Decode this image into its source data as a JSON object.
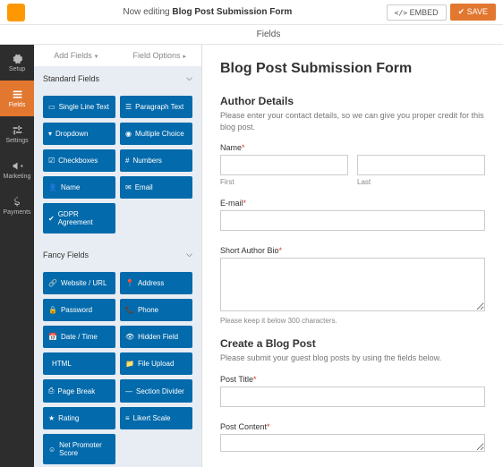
{
  "top": {
    "editing_prefix": "Now editing ",
    "form_name": "Blog Post Submission Form",
    "embed": "EMBED",
    "save": "SAVE"
  },
  "headTab": "Fields",
  "sidebar": [
    {
      "label": "Setup",
      "icon": "gear"
    },
    {
      "label": "Fields",
      "icon": "list"
    },
    {
      "label": "Settings",
      "icon": "sliders"
    },
    {
      "label": "Marketing",
      "icon": "horn"
    },
    {
      "label": "Payments",
      "icon": "dollar"
    }
  ],
  "subtabs": {
    "add": "Add Fields",
    "opts": "Field Options"
  },
  "groups": {
    "standard": {
      "title": "Standard Fields",
      "items": [
        {
          "l": "Single Line Text",
          "i": "line"
        },
        {
          "l": "Paragraph Text",
          "i": "para"
        },
        {
          "l": "Dropdown",
          "i": "dd"
        },
        {
          "l": "Multiple Choice",
          "i": "mc"
        },
        {
          "l": "Checkboxes",
          "i": "cb"
        },
        {
          "l": "Numbers",
          "i": "num"
        },
        {
          "l": "Name",
          "i": "name"
        },
        {
          "l": "Email",
          "i": "mail"
        },
        {
          "l": "GDPR Agreement",
          "i": "gdpr"
        }
      ]
    },
    "fancy": {
      "title": "Fancy Fields",
      "items": [
        {
          "l": "Website / URL",
          "i": "link"
        },
        {
          "l": "Address",
          "i": "pin"
        },
        {
          "l": "Password",
          "i": "lock"
        },
        {
          "l": "Phone",
          "i": "phone"
        },
        {
          "l": "Date / Time",
          "i": "cal"
        },
        {
          "l": "Hidden Field",
          "i": "eye"
        },
        {
          "l": "HTML",
          "i": "code"
        },
        {
          "l": "File Upload",
          "i": "file"
        },
        {
          "l": "Page Break",
          "i": "page"
        },
        {
          "l": "Section Divider",
          "i": "div"
        },
        {
          "l": "Rating",
          "i": "star"
        },
        {
          "l": "Likert Scale",
          "i": "scale"
        },
        {
          "l": "Net Promoter Score",
          "i": "nps"
        }
      ]
    }
  },
  "preview": {
    "title": "Blog Post Submission Form",
    "s1_title": "Author Details",
    "s1_desc": "Please enter your contact details, so we can give you proper credit for this blog post.",
    "name_l": "Name",
    "first": "First",
    "last": "Last",
    "email_l": "E-mail",
    "bio_l": "Short Author Bio",
    "bio_hint": "Please keep it below 300 characters.",
    "s2_title": "Create a Blog Post",
    "s2_desc": "Please submit your guest blog posts by using the fields below.",
    "pt_l": "Post Title",
    "pc_l": "Post Content"
  }
}
